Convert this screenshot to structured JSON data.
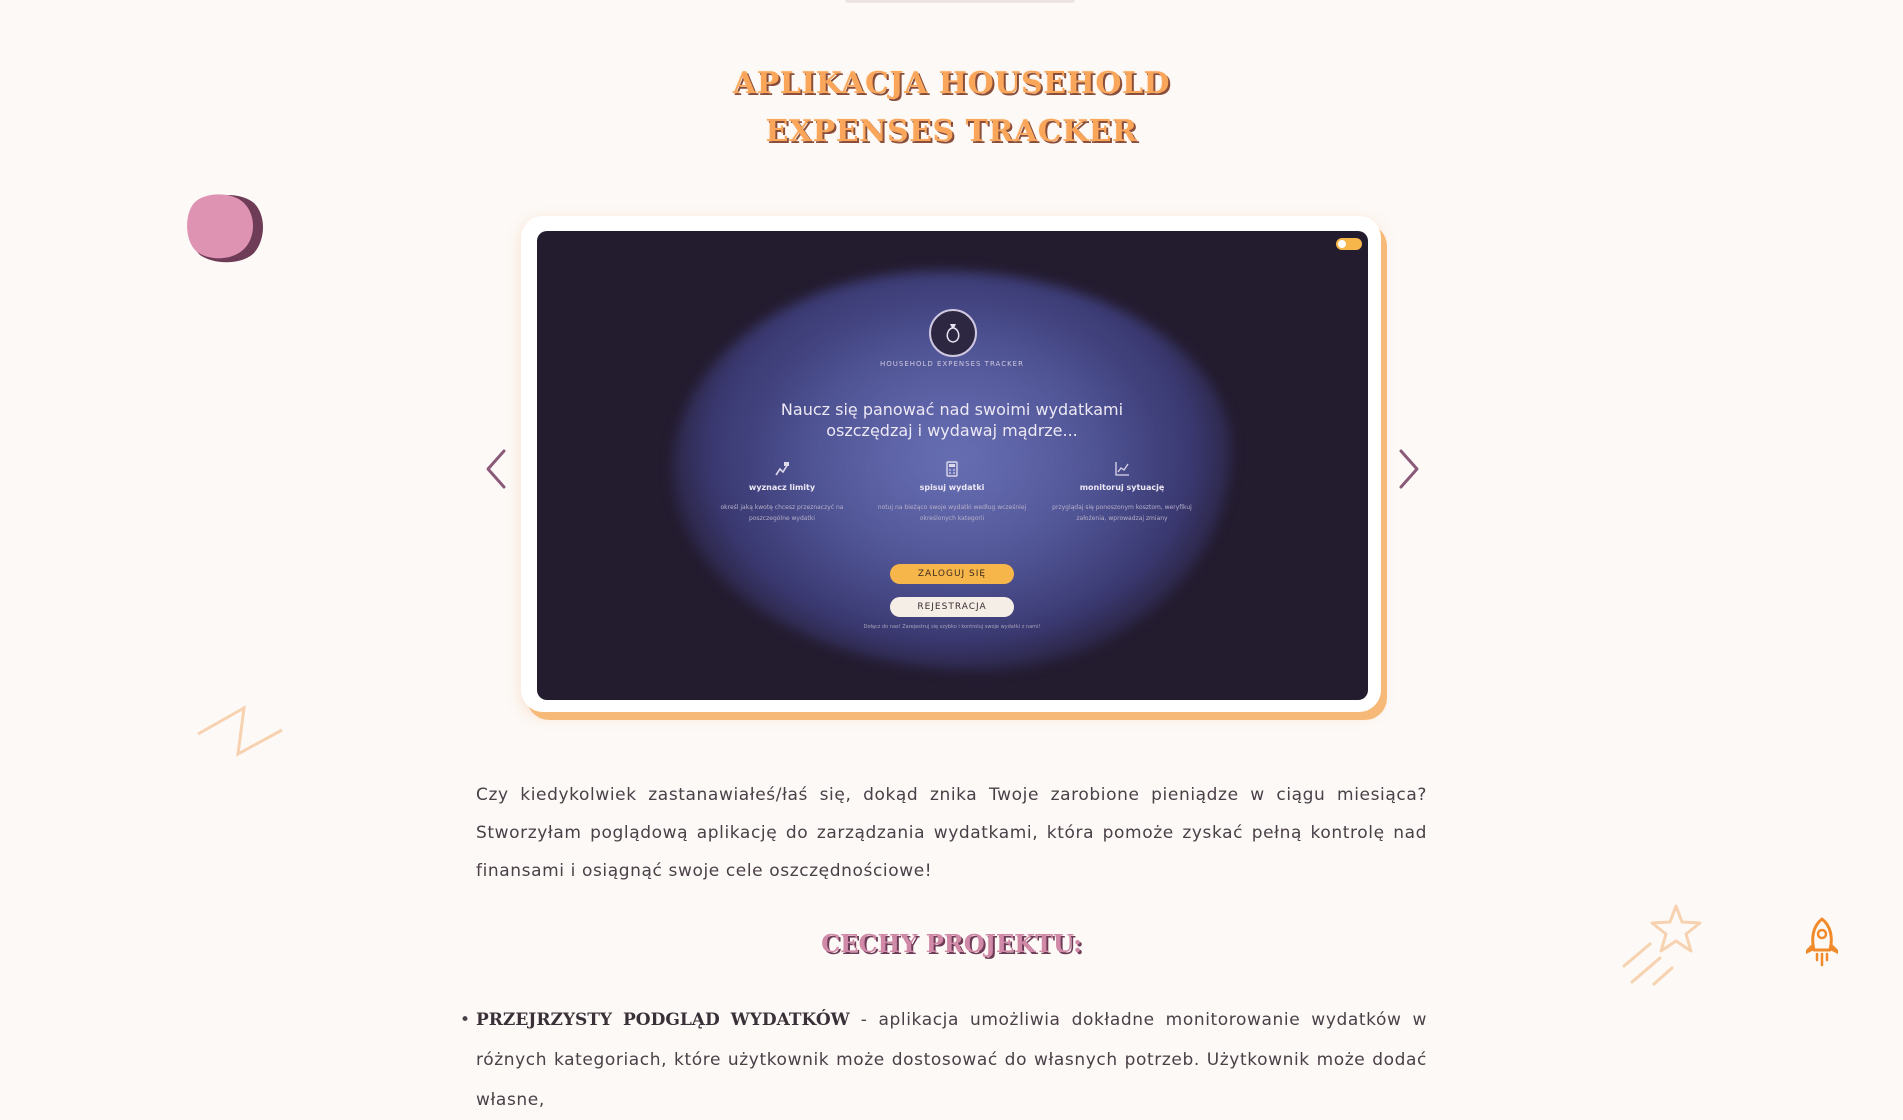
{
  "project": {
    "title_line1": "APLIKACJA HOUSEHOLD",
    "title_line2": "EXPENSES TRACKER"
  },
  "slider": {
    "prev_arrow_icon": "chevron-left-icon",
    "next_arrow_icon": "chevron-right-icon",
    "slide": {
      "app_name": "Household Expenses Tracker",
      "tagline_line1": "Naucz się panować nad swoimi wydatkami",
      "tagline_line2": "oszczędzaj i wydawaj mądrze...",
      "features": [
        {
          "icon": "goal-icon",
          "name": "wyznacz limity",
          "desc": "określ jaką kwotę chcesz przeznaczyć na poszczególne wydatki"
        },
        {
          "icon": "calculator-icon",
          "name": "spisuj wydatki",
          "desc": "notuj na bieżąco swoje wydatki według wcześniej określonych kategorii"
        },
        {
          "icon": "chart-icon",
          "name": "monitoruj sytuację",
          "desc": "przyglądaj się ponoszonym kosztom, weryfikuj założenia, wprowadzaj zmiany"
        }
      ],
      "login_label": "ZALOGUJ SIĘ",
      "register_label": "REJESTRACJA",
      "footnote": "Dołącz do nas! Zarejestruj się szybko i kontroluj swoje wydatki z nami!"
    }
  },
  "intro_text": "Czy kiedykolwiek zastanawiałeś/łaś się, dokąd znika Twoje zarobione pieniądze w ciągu miesiąca? Stworzyłam poglądową aplikację do zarządzania wydatkami, która pomoże zyskać pełną kontrolę nad finansami i osiągnąć swoje cele oszczędnościowe!",
  "features_heading": "CECHY PROJEKTU:",
  "features_list": [
    {
      "title": "PRZEJRZYSTY PODGLĄD WYDATKÓW",
      "text": " - aplikacja umożliwia dokładne monitorowanie wydatków w różnych kategoriach, które użytkownik może dostosować do własnych potrzeb. Użytkownik może dodać własne,"
    }
  ],
  "colors": {
    "accent_orange": "#f9a65a",
    "accent_pink": "#d089a6",
    "background": "#fdf9f6",
    "screen_dark": "#231b2e",
    "button_yellow": "#f7b64a"
  }
}
